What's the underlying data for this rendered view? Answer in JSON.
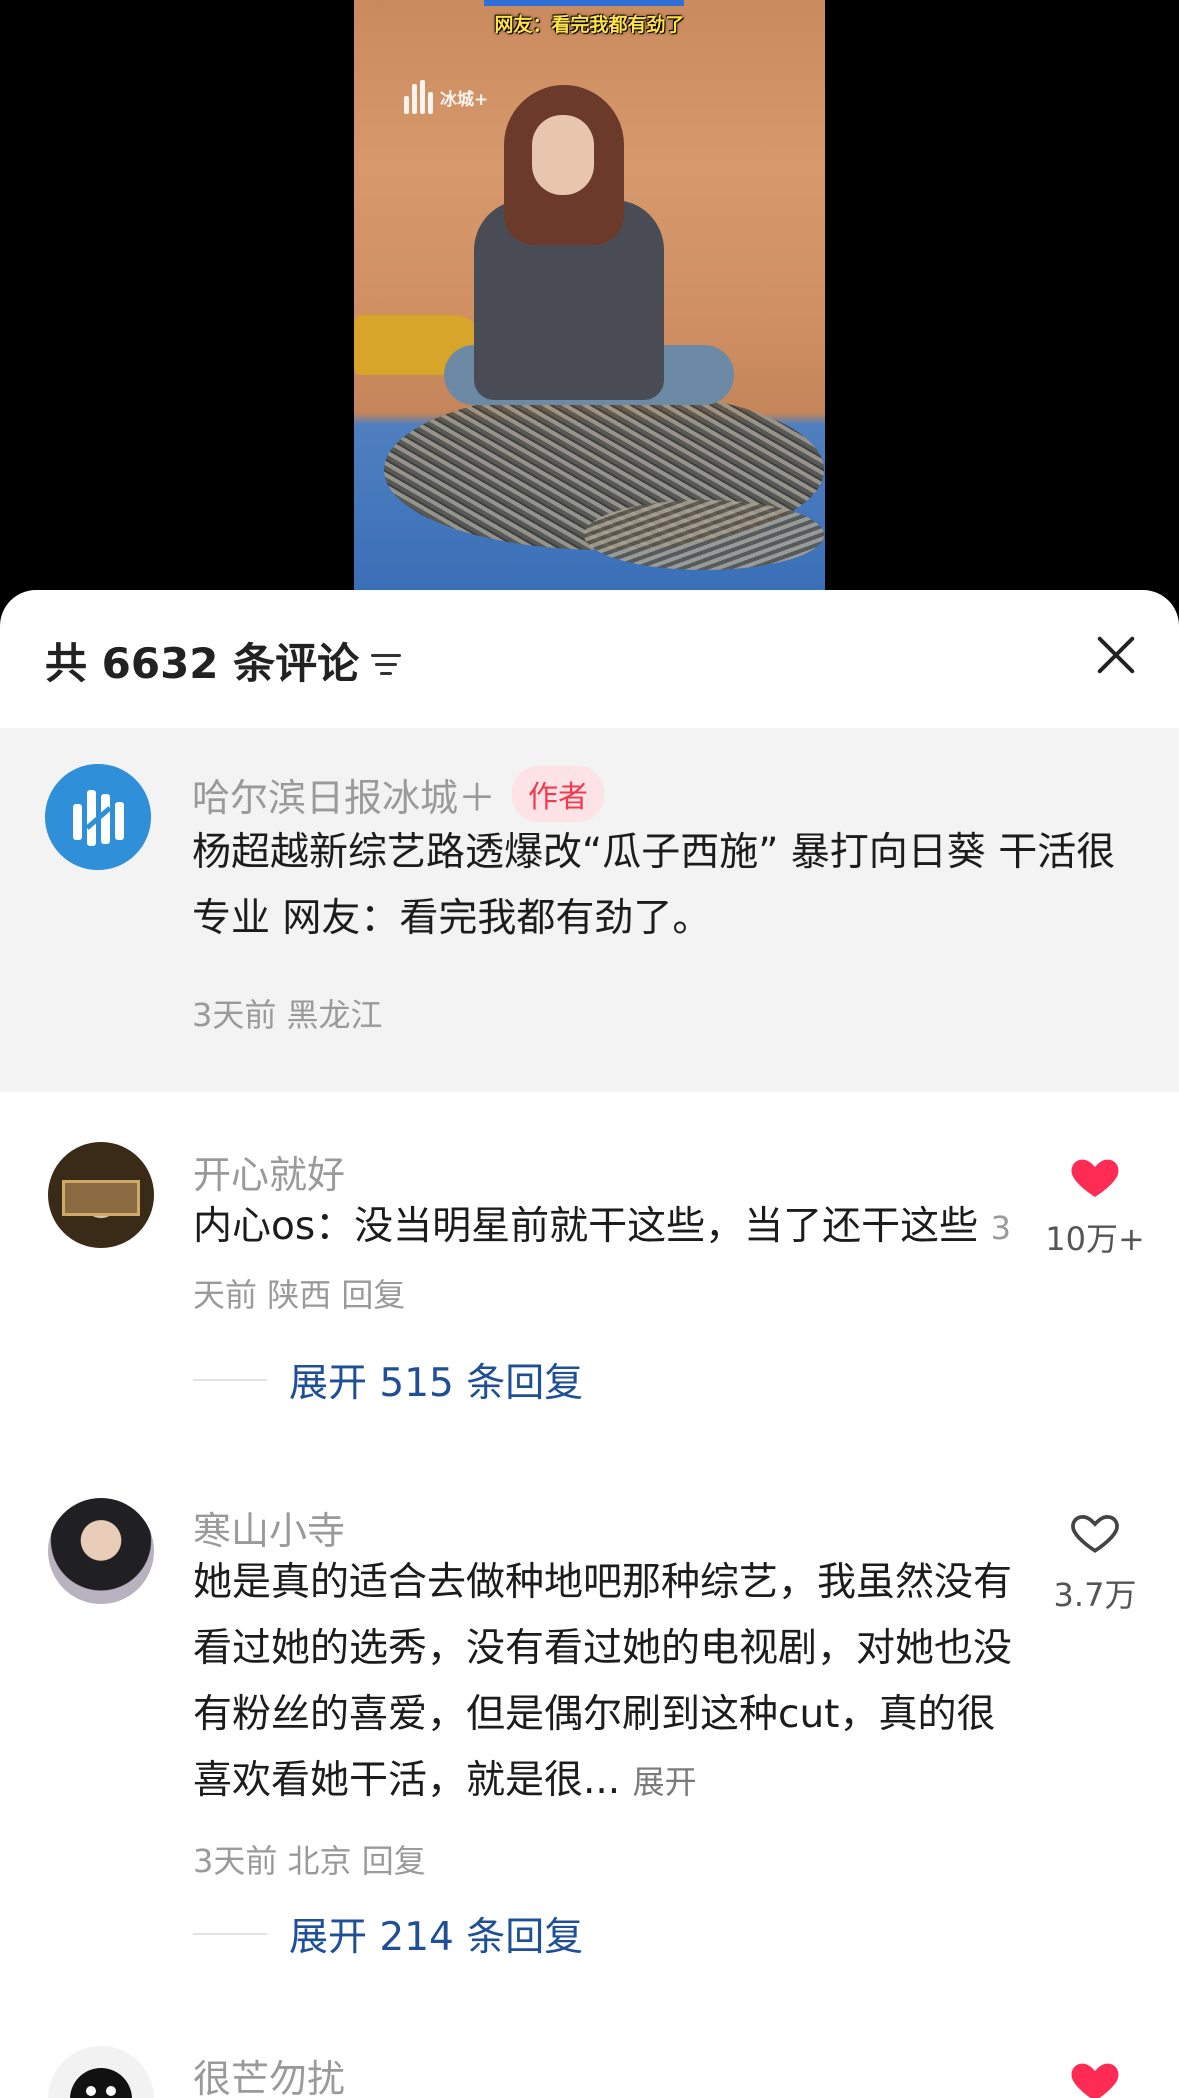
{
  "video": {
    "caption": "网友：看完我都有劲了",
    "watermark": "冰城+"
  },
  "comments_panel": {
    "count_label": "共 6632 条评论",
    "author_post": {
      "username": "哈尔滨日报冰城＋",
      "badge": "作者",
      "text": "杨超越新综艺路透爆改“瓜子西施” 暴打向日葵 干活很专业 网友：看完我都有劲了。",
      "time": "3天前",
      "location": "黑龙江"
    },
    "comments": [
      {
        "username": "开心就好",
        "text": "内心os：没当明星前就干这些，当了还干这些",
        "time": "3天前",
        "location": "陕西",
        "reply_label": "回复",
        "likes": "10万+",
        "liked": true,
        "expand_replies": "展开 515 条回复"
      },
      {
        "username": "寒山小寺",
        "text": "她是真的适合去做种地吧那种综艺，我虽然没有看过她的选秀，没有看过她的电视剧，对她也没有粉丝的喜爱，但是偶尔刷到这种cut，真的很喜欢看她干活，就是很...",
        "expand_text": "展开",
        "time": "3天前",
        "location": "北京",
        "reply_label": "回复",
        "likes": "3.7万",
        "liked": false,
        "expand_replies": "展开 214 条回复"
      },
      {
        "username": "很芒勿扰",
        "liked": true
      }
    ]
  },
  "colors": {
    "like_red": "#fe2c55",
    "link_blue": "#1f4f96",
    "badge_red": "#f2394f"
  }
}
